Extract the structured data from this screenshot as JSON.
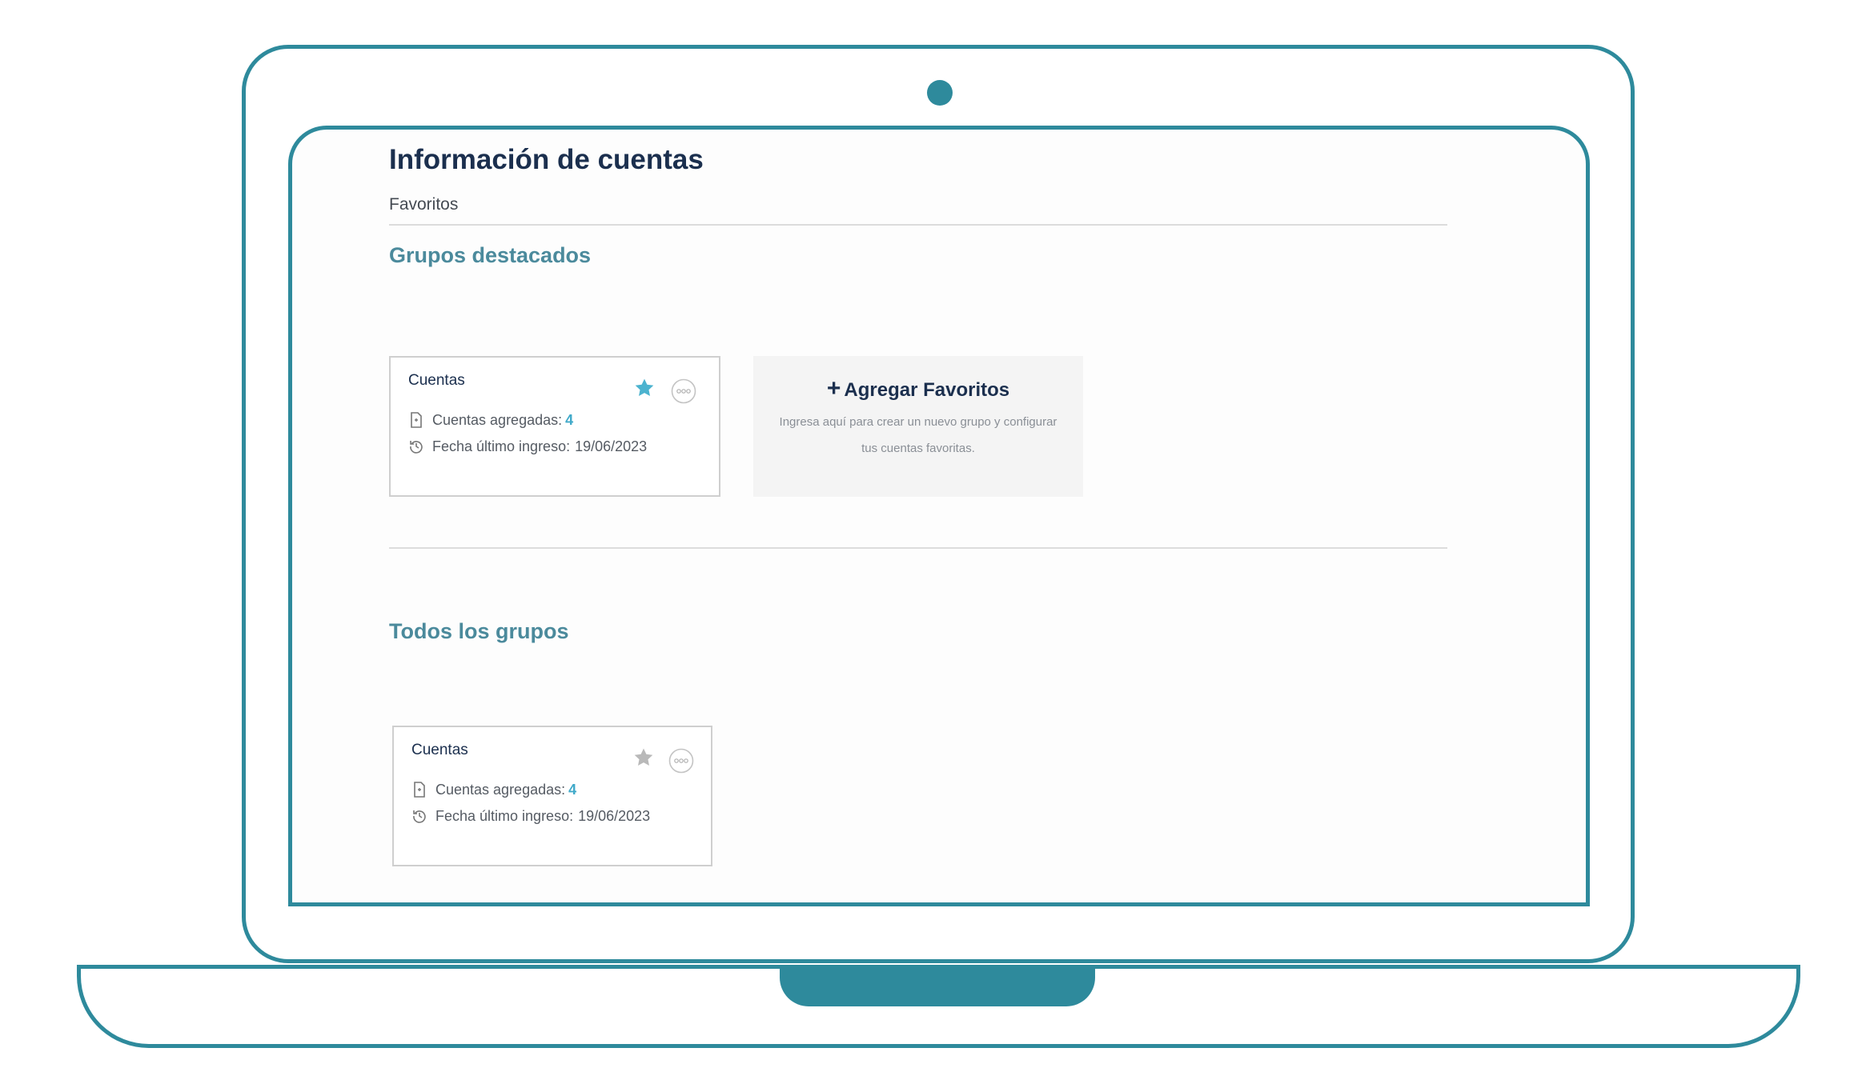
{
  "header": {
    "title": "Información de cuentas",
    "breadcrumb": "Favoritos"
  },
  "featured": {
    "title": "Grupos destacados",
    "card": {
      "name": "Cuentas",
      "accounts_label": "Cuentas agregadas:",
      "accounts_count": "4",
      "last_login_label": "Fecha último ingreso:",
      "last_login_date": "19/06/2023",
      "starred": true,
      "icons": [
        "star-icon",
        "more-options-icon",
        "document-icon",
        "history-icon"
      ]
    },
    "add": {
      "label": "Agregar Favoritos",
      "plus": "+",
      "description": "Ingresa aquí para crear un nuevo grupo y configurar tus cuentas favoritas."
    }
  },
  "all_groups": {
    "title": "Todos los grupos",
    "card": {
      "name": "Cuentas",
      "accounts_label": "Cuentas agregadas:",
      "accounts_count": "4",
      "last_login_label": "Fecha último ingreso:",
      "last_login_date": "19/06/2023",
      "starred": false
    }
  },
  "colors": {
    "frame": "#2e8a9c",
    "title": "#1b2f4e",
    "section": "#4b8a9c",
    "accent": "#3fa9c9",
    "star_active": "#4cb3cf",
    "star_inactive": "#b9b9b9"
  }
}
